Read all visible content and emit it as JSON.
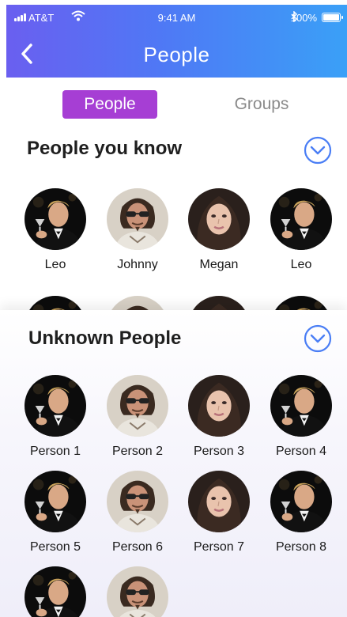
{
  "status_bar": {
    "carrier": "AT&T",
    "time": "9:41 AM",
    "battery": "100%"
  },
  "nav": {
    "title": "People",
    "back_icon": "chevron-left-icon"
  },
  "tabs": [
    {
      "label": "People",
      "active": true
    },
    {
      "label": "Groups",
      "active": false
    }
  ],
  "known": {
    "title": "People you know",
    "toggle_icon": "chevron-down-circle-icon",
    "people": [
      {
        "name": "Leo",
        "style": "leo"
      },
      {
        "name": "Johnny",
        "style": "johnny"
      },
      {
        "name": "Megan",
        "style": "megan"
      },
      {
        "name": "Leo",
        "style": "leo"
      }
    ]
  },
  "unknown": {
    "title": "Unknown People",
    "toggle_icon": "chevron-down-circle-icon",
    "people": [
      {
        "name": "Person 1",
        "style": "leo"
      },
      {
        "name": "Person 2",
        "style": "johnny"
      },
      {
        "name": "Person 3",
        "style": "megan"
      },
      {
        "name": "Person 4",
        "style": "leo"
      },
      {
        "name": "Person 5",
        "style": "leo"
      },
      {
        "name": "Person 6",
        "style": "johnny"
      },
      {
        "name": "Person 7",
        "style": "megan"
      },
      {
        "name": "Person 8",
        "style": "leo"
      },
      {
        "name": "",
        "style": "leo"
      },
      {
        "name": "",
        "style": "johnny"
      }
    ]
  },
  "colors": {
    "accent": "#a63ed4",
    "header_start": "#6a5ff0",
    "header_end": "#3aa0f7",
    "chevron": "#4a7ef5"
  }
}
